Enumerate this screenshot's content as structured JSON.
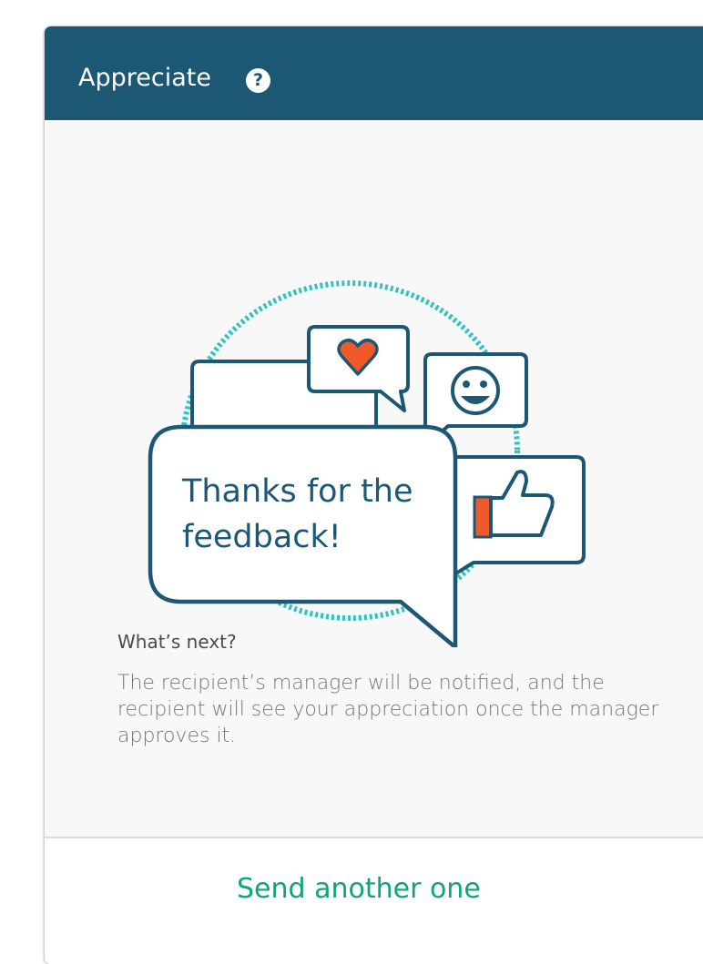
{
  "header": {
    "title": "Appreciate",
    "help_icon": "question-mark-icon",
    "help_glyph": "?"
  },
  "illustration": {
    "line1": "Thanks for the",
    "line2": "feedback!",
    "icons": [
      "heart-icon",
      "smiley-icon",
      "thumbs-up-icon"
    ]
  },
  "next": {
    "title": "What’s next?",
    "description": "The recipient’s manager will be notified, and the recipient will see your appreciation once the manager approves it."
  },
  "footer": {
    "send_another_label": "Send another one"
  },
  "colors": {
    "header_bg": "#1c5874",
    "accent_teal": "#2ec3c3",
    "accent_orange": "#f05a2a",
    "link_green": "#0fa47c"
  }
}
